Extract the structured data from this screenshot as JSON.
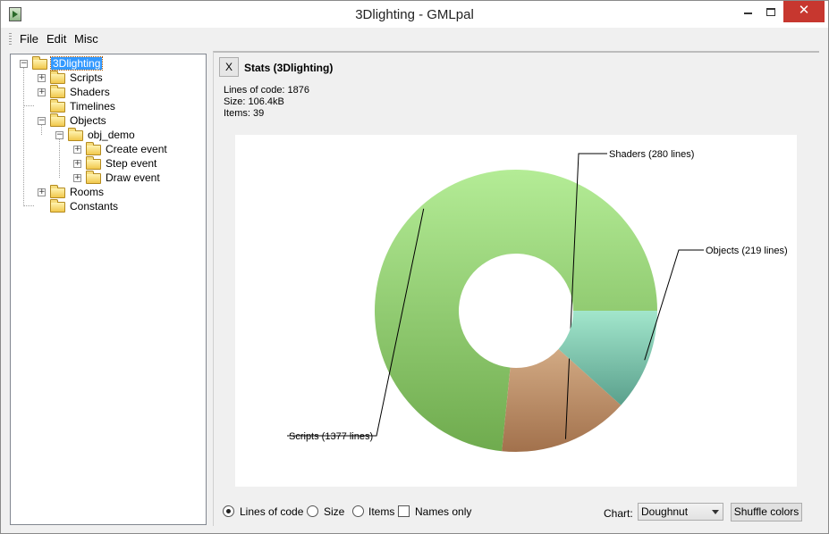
{
  "window": {
    "title": "3Dlighting - GMLpal",
    "minimize_label": "",
    "maximize_label": "",
    "close_label": "✕"
  },
  "menu": {
    "items": [
      "File",
      "Edit",
      "Misc"
    ]
  },
  "tree": {
    "nodes": [
      {
        "label": "3Dlighting",
        "expander": "−",
        "selected": true
      },
      {
        "label": "Scripts",
        "expander": "+"
      },
      {
        "label": "Shaders",
        "expander": "+"
      },
      {
        "label": "Timelines",
        "expander": ""
      },
      {
        "label": "Objects",
        "expander": "−"
      },
      {
        "label": "obj_demo",
        "expander": "−"
      },
      {
        "label": "Create event",
        "expander": "+"
      },
      {
        "label": "Step event",
        "expander": "+"
      },
      {
        "label": "Draw event",
        "expander": "+"
      },
      {
        "label": "Rooms",
        "expander": "+"
      },
      {
        "label": "Constants",
        "expander": ""
      }
    ]
  },
  "stats": {
    "close_label": "X",
    "title": "Stats (3Dlighting)",
    "lines_of_code": "Lines of code: 1876",
    "size": "Size: 106.4kB",
    "items": "Items: 39"
  },
  "chart_data": {
    "type": "pie",
    "variant": "doughnut",
    "series": [
      {
        "name": "Scripts",
        "label": "Scripts (1377 lines)",
        "value": 1377,
        "color_light": "#b4ec96",
        "color_dark": "#6fab4e"
      },
      {
        "name": "Shaders",
        "label": "Shaders (280 lines)",
        "value": 280,
        "color_light": "#d2aa84",
        "color_dark": "#a2714c"
      },
      {
        "name": "Objects",
        "label": "Objects (219 lines)",
        "value": 219,
        "color_light": "#a2e6cc",
        "color_dark": "#5aa08c"
      }
    ],
    "start_angle_deg": 0,
    "direction": "counterclockwise"
  },
  "controls": {
    "options": [
      {
        "label": "Lines of code",
        "kind": "radio",
        "checked": true
      },
      {
        "label": "Size",
        "kind": "radio",
        "checked": false
      },
      {
        "label": "Items",
        "kind": "radio",
        "checked": false
      },
      {
        "label": "Names only",
        "kind": "checkbox",
        "checked": false
      }
    ],
    "chart_label": "Chart:",
    "chart_type": "Doughnut",
    "shuffle_label": "Shuffle colors"
  }
}
